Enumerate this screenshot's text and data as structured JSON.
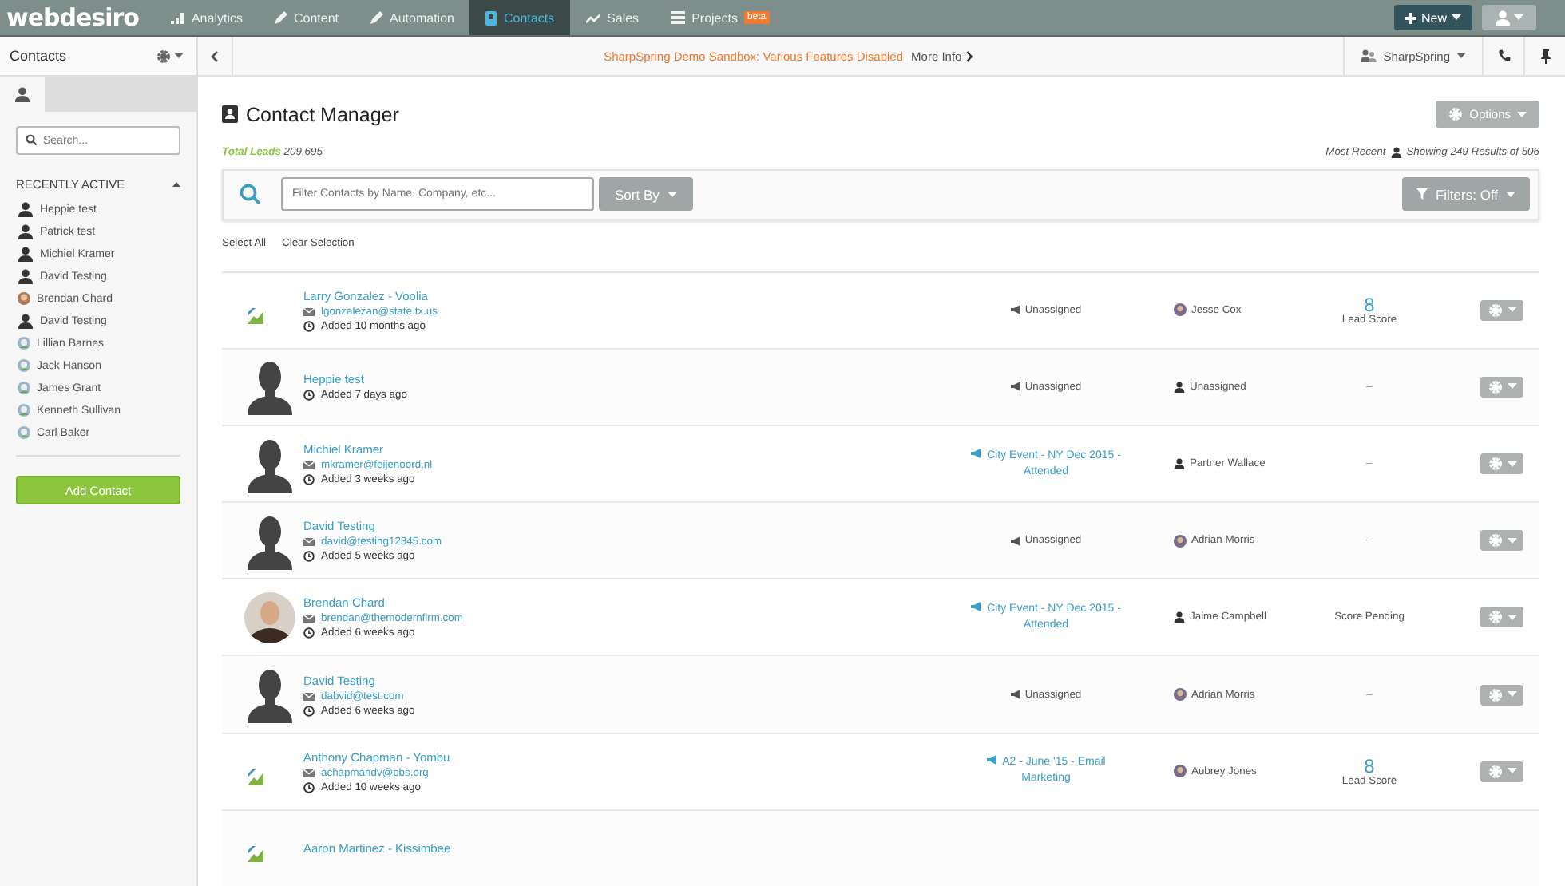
{
  "top_nav": {
    "logo": "webdesiro",
    "items": [
      {
        "label": "Analytics",
        "selected": false
      },
      {
        "label": "Content",
        "selected": false
      },
      {
        "label": "Automation",
        "selected": false
      },
      {
        "label": "Contacts",
        "selected": true
      },
      {
        "label": "Sales",
        "selected": false
      },
      {
        "label": "Projects",
        "selected": false,
        "badge": "beta"
      }
    ],
    "new_button": "New"
  },
  "sidebar": {
    "title": "Contacts",
    "search": {
      "placeholder": "Search..."
    },
    "section_title": "RECENTLY ACTIVE",
    "items": [
      {
        "label": "Heppie test",
        "kind": "person"
      },
      {
        "label": "Patrick test",
        "kind": "person"
      },
      {
        "label": "Michiel Kramer",
        "kind": "person"
      },
      {
        "label": "David Testing",
        "kind": "person"
      },
      {
        "label": "Brendan Chard",
        "kind": "photo"
      },
      {
        "label": "David Testing",
        "kind": "person"
      },
      {
        "label": "Lillian Barnes",
        "kind": "gravatar"
      },
      {
        "label": "Jack Hanson",
        "kind": "gravatar"
      },
      {
        "label": "James Grant",
        "kind": "gravatar"
      },
      {
        "label": "Kenneth Sullivan",
        "kind": "gravatar"
      },
      {
        "label": "Carl Baker",
        "kind": "gravatar"
      }
    ],
    "add_button": "Add Contact"
  },
  "banner": {
    "message": "SharpSpring Demo Sandbox: Various Features Disabled",
    "link": "More Info",
    "account": "SharpSpring"
  },
  "main": {
    "title": "Contact Manager",
    "total_label": "Total Leads",
    "total_value": "209,695",
    "sort_label": "Most Recent",
    "results": "Showing 249 Results of 506",
    "options_button": "Options",
    "filter": {
      "placeholder": "Filter Contacts by Name, Company, etc...",
      "sort_button": "Sort By",
      "filters_button": "Filters: Off"
    },
    "select_all": "Select All",
    "clear_selection": "Clear Selection",
    "rows": [
      {
        "avatar": {
          "kind": "broken"
        },
        "name": "Larry Gonzalez - Voolia",
        "email": "lgonzalezan@state.tx.us",
        "added": "Added 10 months ago",
        "campaign": {
          "kind": "unassigned",
          "label": "Unassigned"
        },
        "owner": {
          "kind": "avatar",
          "label": "Jesse Cox"
        },
        "score": {
          "kind": "score",
          "value": "8",
          "label": "Lead Score"
        }
      },
      {
        "avatar": {
          "kind": "silhouette"
        },
        "name": "Heppie test",
        "added": "Added 7 days ago",
        "campaign": {
          "kind": "unassigned",
          "label": "Unassigned"
        },
        "owner": {
          "kind": "person",
          "label": "Unassigned"
        },
        "score": {
          "kind": "none",
          "value": "–"
        }
      },
      {
        "avatar": {
          "kind": "silhouette"
        },
        "name": "Michiel Kramer",
        "email": "mkramer@feijenoord.nl",
        "added": "Added 3 weeks ago",
        "campaign": {
          "kind": "campaign",
          "label": "City Event - NY Dec 2015 - Attended"
        },
        "owner": {
          "kind": "person",
          "label": "Partner Wallace"
        },
        "score": {
          "kind": "none",
          "value": "–"
        }
      },
      {
        "avatar": {
          "kind": "silhouette"
        },
        "name": "David Testing",
        "email": "david@testing12345.com",
        "added": "Added 5 weeks ago",
        "campaign": {
          "kind": "unassigned",
          "label": "Unassigned"
        },
        "owner": {
          "kind": "avatar",
          "label": "Adrian Morris"
        },
        "score": {
          "kind": "none",
          "value": "–"
        }
      },
      {
        "avatar": {
          "kind": "photo"
        },
        "name": "Brendan Chard",
        "email": "brendan@themodernfirm.com",
        "added": "Added 6 weeks ago",
        "campaign": {
          "kind": "campaign",
          "label": "City Event - NY Dec 2015 - Attended"
        },
        "owner": {
          "kind": "person",
          "label": "Jaime Campbell"
        },
        "score": {
          "kind": "pending",
          "value": "Score Pending"
        }
      },
      {
        "avatar": {
          "kind": "silhouette"
        },
        "name": "David Testing",
        "email": "dabvid@test.com",
        "added": "Added 6 weeks ago",
        "campaign": {
          "kind": "unassigned",
          "label": "Unassigned"
        },
        "owner": {
          "kind": "avatar",
          "label": "Adrian Morris"
        },
        "score": {
          "kind": "none",
          "value": "–"
        }
      },
      {
        "avatar": {
          "kind": "broken"
        },
        "name": "Anthony Chapman - Yombu",
        "email": "achapmandv@pbs.org",
        "added": "Added 10 weeks ago",
        "campaign": {
          "kind": "campaign",
          "label": "A2 - June '15 - Email Marketing"
        },
        "owner": {
          "kind": "avatar",
          "label": "Aubrey Jones"
        },
        "score": {
          "kind": "score",
          "value": "8",
          "label": "Lead Score"
        }
      },
      {
        "avatar": {
          "kind": "broken"
        },
        "name": "Aaron Martinez - Kissimbee"
      }
    ]
  }
}
